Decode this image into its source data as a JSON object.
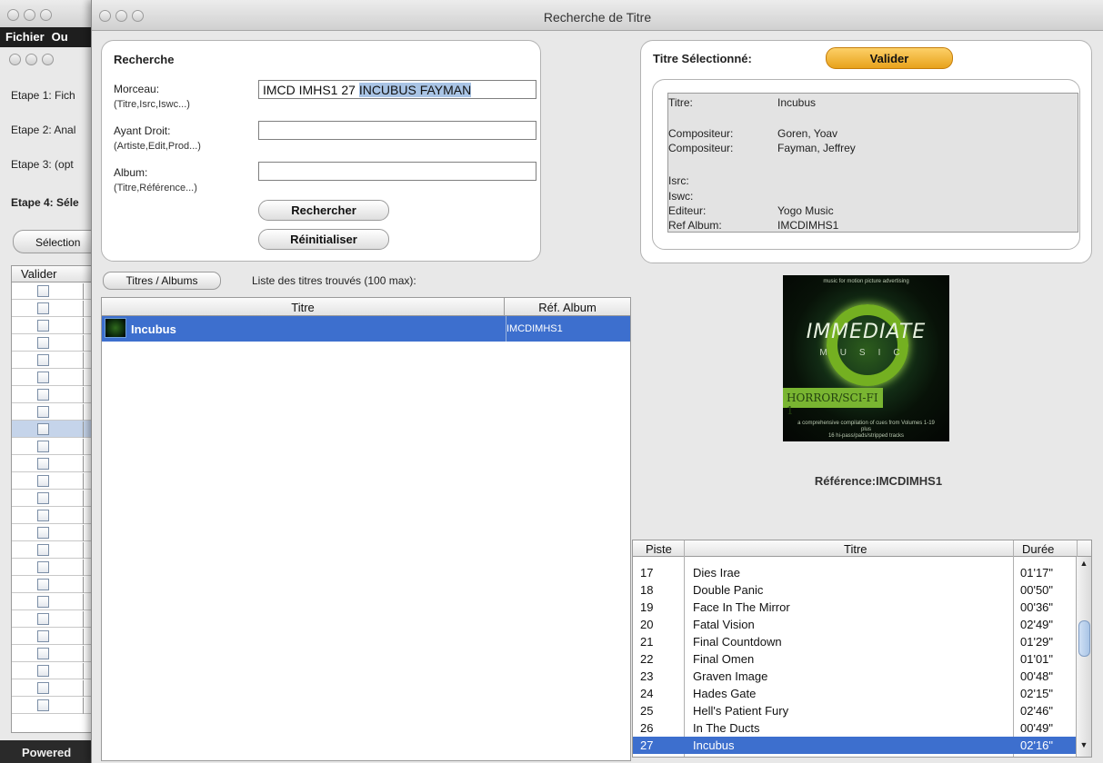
{
  "background_window": {
    "menu": [
      "Fichier",
      "Ou"
    ],
    "steps": [
      "Etape 1: Fich",
      "Etape 2: Anal",
      "Etape 3: (opt",
      "Etape 4: Séle"
    ],
    "select_button": "Sélection",
    "table_header": "Valider",
    "row_numbers": [
      "0",
      "0",
      "0",
      "0",
      "1",
      "1",
      "1",
      "1",
      "1",
      "1",
      "1",
      "1",
      "1",
      "1",
      "1",
      "1",
      "1",
      "1",
      "1",
      "1",
      "1",
      "1",
      "1",
      "1",
      "1"
    ],
    "powered": "Powered"
  },
  "window": {
    "title": "Recherche de Titre"
  },
  "search": {
    "heading": "Recherche",
    "morceau_label": "Morceau:",
    "morceau_sub": "(Titre,Isrc,Iswc...)",
    "morceau_value_plain": "IMCD IMHS1 27 ",
    "morceau_value_selected": "INCUBUS FAYMAN",
    "ayant_label": "Ayant Droit:",
    "ayant_sub": "(Artiste,Edit,Prod...)",
    "ayant_value": "",
    "album_label": "Album:",
    "album_sub": "(Titre,Référence...)",
    "album_value": "",
    "search_button": "Rechercher",
    "reset_button": "Réinitialiser"
  },
  "selected": {
    "heading": "Titre Sélectionné:",
    "validate_button": "Valider",
    "fields": [
      {
        "label": "Titre:",
        "value": "Incubus"
      },
      {
        "label": "Compositeur:",
        "value": "Goren, Yoav"
      },
      {
        "label": "Compositeur:",
        "value": "Fayman, Jeffrey"
      },
      {
        "label": "Isrc:",
        "value": ""
      },
      {
        "label": "Iswc:",
        "value": ""
      },
      {
        "label": "Editeur:",
        "value": "Yogo Music"
      },
      {
        "label": "Ref Album:",
        "value": "IMCDIMHS1"
      }
    ]
  },
  "results": {
    "toggle_button": "Titres / Albums",
    "caption": "Liste des titres trouvés (100 max):",
    "col_title": "Titre",
    "col_ref": "Réf. Album",
    "row_title": "Incubus",
    "row_ref": "IMCDIMHS1"
  },
  "album": {
    "cover_top": "music for motion picture advertising",
    "cover_brand": "IMMEDIATE",
    "cover_music": "MUSIC",
    "cover_band": "HORROR/SCI-FI 1",
    "cover_small1": "a comprehensive compilation of cues from Volumes 1-19",
    "cover_small2": "plus",
    "cover_small3": "16 hi-pass/pads/stripped tracks",
    "reference": "Référence:IMCDIMHS1"
  },
  "tracks": {
    "col_piste": "Piste",
    "col_titre": "Titre",
    "col_duree": "Durée",
    "rows": [
      {
        "n": "17",
        "t": "Dies Irae",
        "d": "01'17\""
      },
      {
        "n": "18",
        "t": "Double Panic",
        "d": "00'50\""
      },
      {
        "n": "19",
        "t": "Face In The Mirror",
        "d": "00'36\""
      },
      {
        "n": "20",
        "t": "Fatal Vision",
        "d": "02'49\""
      },
      {
        "n": "21",
        "t": "Final Countdown",
        "d": "01'29\""
      },
      {
        "n": "22",
        "t": "Final Omen",
        "d": "01'01\""
      },
      {
        "n": "23",
        "t": "Graven Image",
        "d": "00'48\""
      },
      {
        "n": "24",
        "t": "Hades Gate",
        "d": "02'15\""
      },
      {
        "n": "25",
        "t": "Hell's Patient Fury",
        "d": "02'46\""
      },
      {
        "n": "26",
        "t": "In The Ducts",
        "d": "00'49\""
      },
      {
        "n": "27",
        "t": "Incubus",
        "d": "02'16\""
      }
    ]
  },
  "colors": {
    "selection": "#3d6fce",
    "validate": "#e8a21b"
  }
}
